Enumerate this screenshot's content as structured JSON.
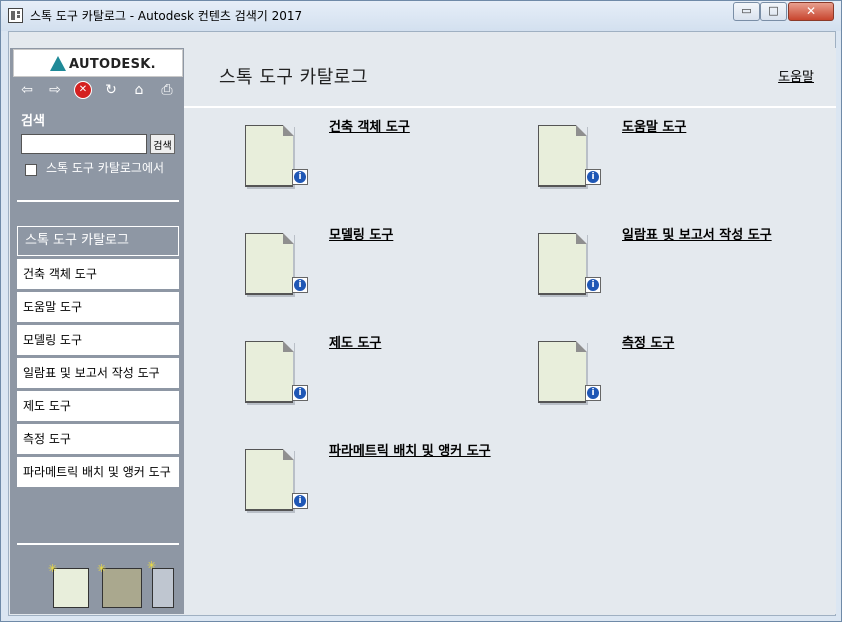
{
  "window": {
    "title": "스톡 도구 카탈로그 - Autodesk 컨텐츠 검색기 2017",
    "minimize_glyph": "▭",
    "maximize_glyph": "□",
    "close_glyph": "✕"
  },
  "sidebar": {
    "logo_text": "AUTODESK.",
    "nav_icons": [
      "back-arrow-icon",
      "forward-arrow-icon",
      "stop-icon",
      "refresh-icon",
      "home-icon",
      "print-icon"
    ],
    "back_glyph": "⇦",
    "forward_glyph": "⇨",
    "stop_glyph": "✕",
    "refresh_glyph": "↻",
    "home_glyph": "⌂",
    "print_glyph": "⎙",
    "search_label": "검색",
    "search_placeholder": "",
    "search_value": "",
    "search_button": "검색",
    "search_scope_label": "스톡 도구 카탈로그에서",
    "search_scope_checked": false,
    "items": [
      {
        "label": "스톡 도구 카탈로그",
        "active": true
      },
      {
        "label": "건축 객체 도구"
      },
      {
        "label": "도움말 도구"
      },
      {
        "label": "모델링 도구"
      },
      {
        "label": "일람표 및 보고서 작성 도구"
      },
      {
        "label": "제도 도구"
      },
      {
        "label": "측정 도구"
      },
      {
        "label": "파라메트릭 배치 및 앵커 도구"
      }
    ],
    "bottom_icons": [
      "new-catalog-icon",
      "new-palette-icon",
      "new-tool-icon"
    ],
    "accent_color": "#8e97a4"
  },
  "main": {
    "title": "스톡 도구 카탈로그",
    "help_link": "도움말",
    "tools": [
      {
        "label": "건축 객체 도구"
      },
      {
        "label": "도움말 도구"
      },
      {
        "label": "모델링 도구"
      },
      {
        "label": "일람표 및 보고서 작성 도구"
      },
      {
        "label": "제도 도구"
      },
      {
        "label": "측정 도구"
      },
      {
        "label": "파라메트릭 배치 및 앵커 도구"
      }
    ],
    "info_glyph": "i"
  }
}
